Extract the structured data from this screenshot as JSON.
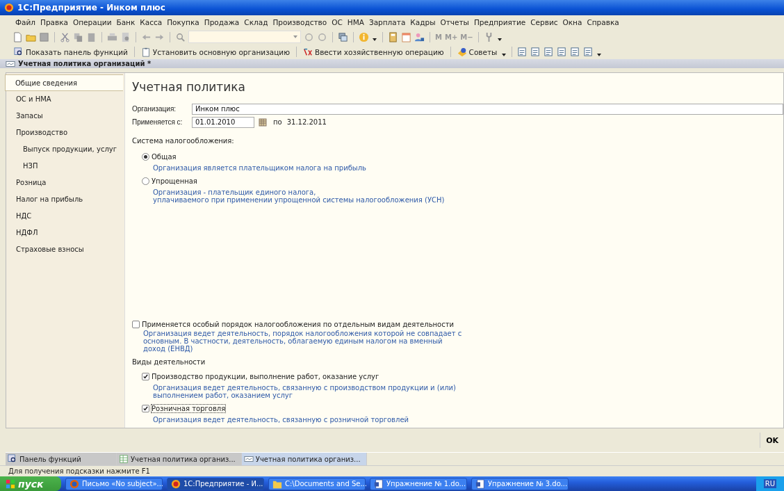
{
  "window": {
    "title": "1С:Предприятие - Инком плюс"
  },
  "menu": [
    {
      "label": "Файл"
    },
    {
      "label": "Правка"
    },
    {
      "label": "Операции"
    },
    {
      "label": "Банк"
    },
    {
      "label": "Касса"
    },
    {
      "label": "Покупка"
    },
    {
      "label": "Продажа"
    },
    {
      "label": "Склад"
    },
    {
      "label": "Производство"
    },
    {
      "label": "ОС"
    },
    {
      "label": "НМА"
    },
    {
      "label": "Зарплата"
    },
    {
      "label": "Кадры"
    },
    {
      "label": "Отчеты"
    },
    {
      "label": "Предприятие"
    },
    {
      "label": "Сервис"
    },
    {
      "label": "Окна"
    },
    {
      "label": "Справка"
    }
  ],
  "toolbar": {
    "memory_buttons": [
      "M",
      "M+",
      "M−"
    ]
  },
  "actions_bar": [
    {
      "label": "Показать панель функций"
    },
    {
      "label": "Установить основную организацию"
    },
    {
      "label": "Ввести хозяйственную операцию"
    },
    {
      "label": "Советы"
    }
  ],
  "document": {
    "title": "Учетная политика организаций *"
  },
  "sidebar": {
    "items": [
      {
        "label": "Общие сведения",
        "selected": true
      },
      {
        "label": "ОС и НМА",
        "selected": false
      },
      {
        "label": "Запасы",
        "selected": false
      },
      {
        "label": "Производство",
        "selected": false,
        "children": [
          {
            "label": "Выпуск продукции, услуг",
            "selected": false
          },
          {
            "label": "НЗП",
            "selected": false
          }
        ]
      },
      {
        "label": "Розница",
        "selected": false
      },
      {
        "label": "Налог на прибыль",
        "selected": false
      },
      {
        "label": "НДС",
        "selected": false
      },
      {
        "label": "НДФЛ",
        "selected": false
      },
      {
        "label": "Страховые взносы",
        "selected": false
      }
    ]
  },
  "form": {
    "heading": "Учетная политика",
    "organization": {
      "label": "Организация:",
      "value": "Инком плюс"
    },
    "applies_from": {
      "label": "Применяется с:",
      "value": "01.01.2010",
      "to_label": "по",
      "to_value": "31.12.2011"
    },
    "tax_system": {
      "label": "Система налогообложения:",
      "options": [
        {
          "label": "Общая",
          "selected": true,
          "hint": "Организация является плательщиком налога на прибыль"
        },
        {
          "label": "Упрощенная",
          "selected": false,
          "hint": "Организация - плательщик единого налога,\nуплачиваемого при применении упрощенной системы налогообложения (УСН)"
        }
      ]
    },
    "special_order": {
      "label": "Применяется особый порядок налогообложения по отдельным видам деятельности",
      "checked": false,
      "hint": "Организация ведет деятельность, порядок налогообложения которой не совпадает с\nосновным. В частности, деятельность, облагаемую единым налогом на вменный\nдоход (ЕНВД)"
    },
    "activities": {
      "label": "Виды деятельности",
      "items": [
        {
          "label": "Производство  продукции, выполнение работ, оказание услуг",
          "checked": true,
          "focused": false,
          "hint": "Организация ведет деятельность, связанную с производством продукции и (или)\nвыполнением работ, оказанием услуг"
        },
        {
          "label": "Розничная торговля",
          "checked": true,
          "focused": true,
          "hint": "Организация ведет деятельность, связанную с розничной торговлей"
        }
      ]
    }
  },
  "ok_button": "OK",
  "window_tabs": [
    {
      "label": "Панель функций",
      "selected": false
    },
    {
      "label": "Учетная политика организ...",
      "selected": false
    },
    {
      "label": "Учетная политика организ...",
      "selected": true
    }
  ],
  "status_bar": "Для получения подсказки нажмите F1",
  "taskbar": {
    "start": "пуск",
    "items": [
      {
        "label": "Письмо «No subject»...",
        "selected": false
      },
      {
        "label": "1С:Предприятие - И...",
        "selected": true
      },
      {
        "label": "C:\\Documents and Se...",
        "selected": false
      },
      {
        "label": "Упражнение № 1.do...",
        "selected": false
      },
      {
        "label": "Упражнение № 3.do...",
        "selected": false
      }
    ],
    "language": "RU"
  }
}
